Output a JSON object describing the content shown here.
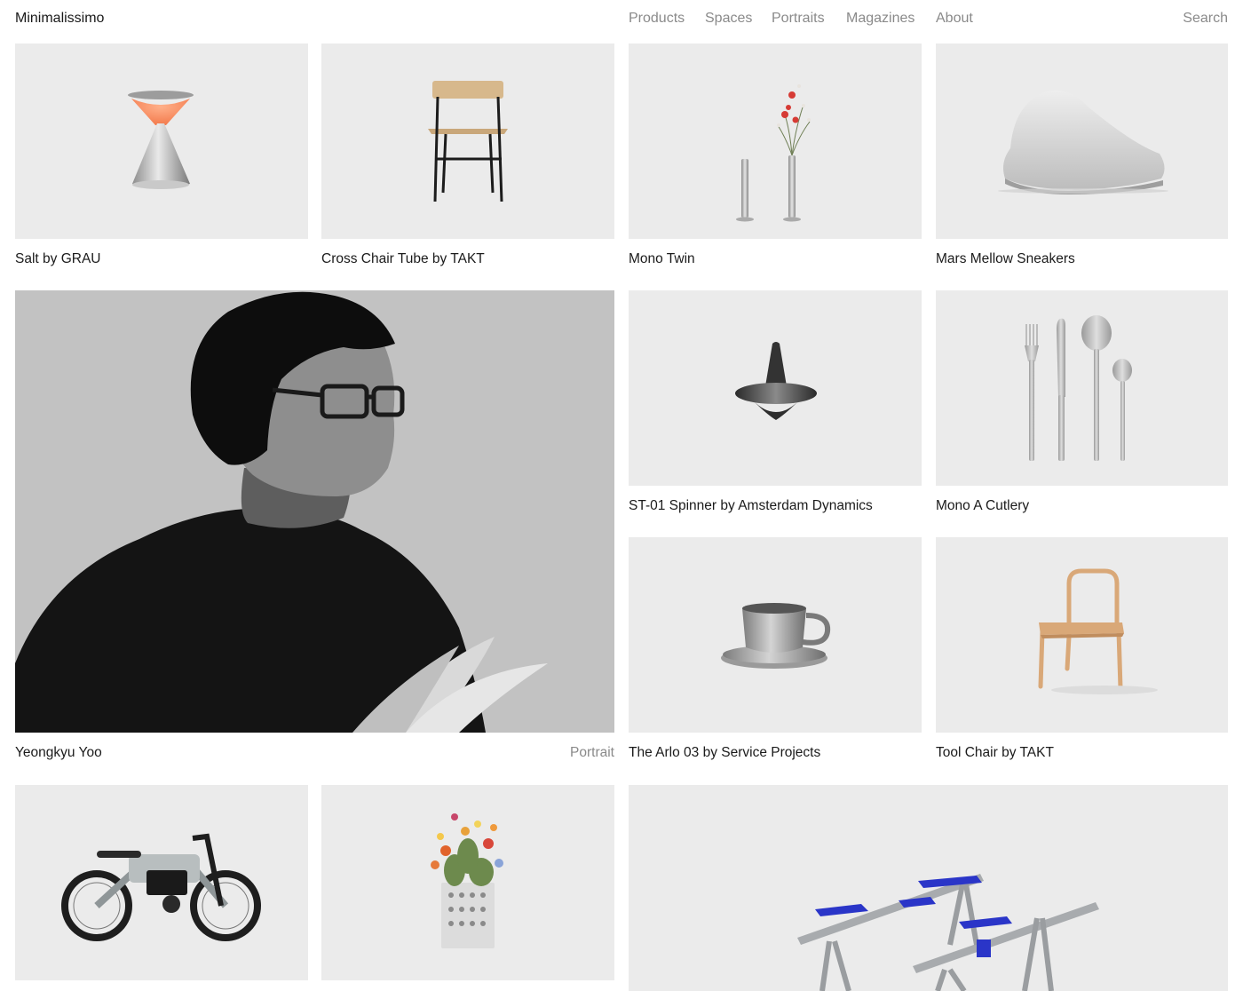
{
  "site": {
    "logo": "Minimalissimo",
    "nav": [
      "Products",
      "Spaces",
      "Portraits",
      "Magazines",
      "About"
    ],
    "search": "Search"
  },
  "cards": {
    "salt": {
      "title": "Salt by GRAU"
    },
    "cross_chair": {
      "title": "Cross Chair Tube by TAKT"
    },
    "mono_twin": {
      "title": "Mono Twin"
    },
    "mars_mellow": {
      "title": "Mars Mellow Sneakers"
    },
    "portrait": {
      "title": "Yeongkyu Yoo",
      "tag": "Portrait"
    },
    "spinner": {
      "title": "ST-01 Spinner by Amsterdam Dynamics"
    },
    "cutlery": {
      "title": "Mono A Cutlery"
    },
    "arlo": {
      "title": "The Arlo 03 by Service Projects"
    },
    "tool_chair": {
      "title": "Tool Chair by TAKT"
    }
  },
  "colors": {
    "thumb_bg": "#ebebeb",
    "nav_text": "#8a8a8a",
    "accent_blue": "#2a35c8",
    "chair_wood": "#d9a878"
  }
}
